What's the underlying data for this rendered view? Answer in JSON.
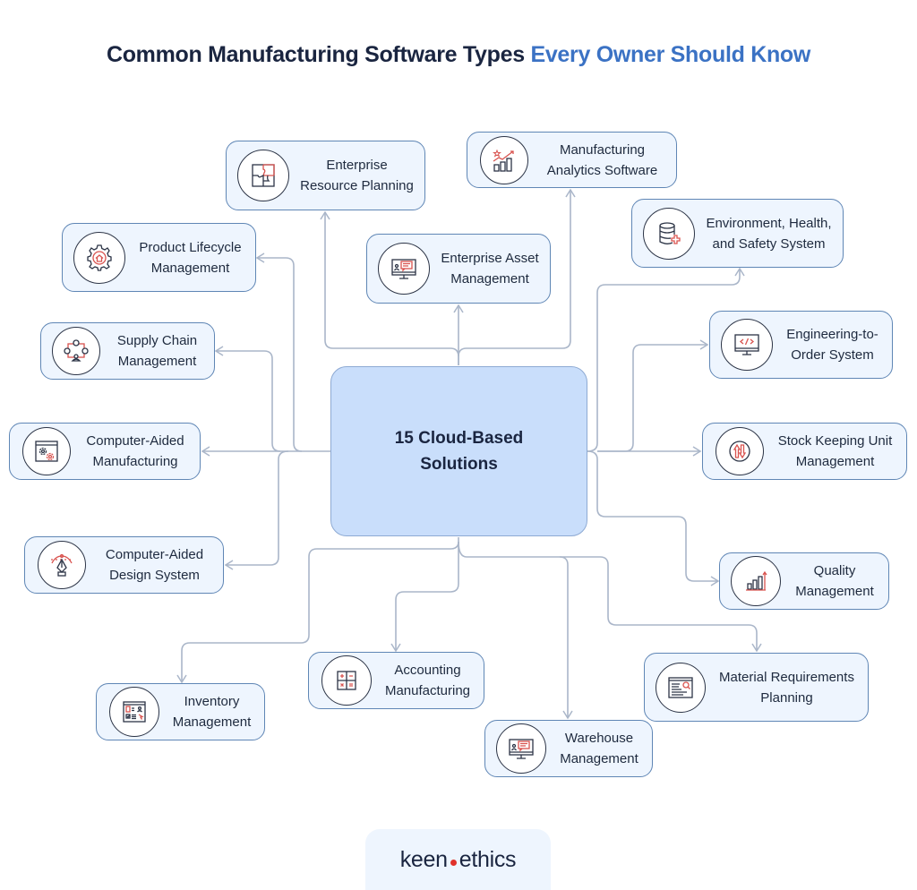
{
  "title": {
    "main": "Common Manufacturing Software Types",
    "accent": "Every Owner Should Know"
  },
  "colors": {
    "title": "#1a2540",
    "accent": "#3b72c4",
    "node_fill": "#eef5fe",
    "node_border": "#5f86b5",
    "center_fill": "#c9defb",
    "connector": "#aab6c9",
    "icon_red": "#d9534f"
  },
  "center": {
    "line1": "15 Cloud-Based",
    "line2": "Solutions"
  },
  "nodes": [
    {
      "id": "erp",
      "label": "Enterprise Resource Planning",
      "icon": "puzzle-icon"
    },
    {
      "id": "analytics",
      "label": "Manufacturing Analytics Software",
      "icon": "analytics-chart-icon"
    },
    {
      "id": "ehs",
      "label": "Environment, Health, and Safety System",
      "icon": "database-plus-icon"
    },
    {
      "id": "plm",
      "label": "Product Lifecycle Management",
      "icon": "gear-home-icon"
    },
    {
      "id": "eam",
      "label": "Enterprise Asset Management",
      "icon": "monitor-chat-icon"
    },
    {
      "id": "eto",
      "label": "Engineering-to-Order System",
      "icon": "monitor-code-icon"
    },
    {
      "id": "scm",
      "label": "Supply Chain Management",
      "icon": "supply-network-icon"
    },
    {
      "id": "cam",
      "label": "Computer-Aided Manufacturing",
      "icon": "window-gears-icon"
    },
    {
      "id": "sku",
      "label": "Stock Keeping Unit Management",
      "icon": "up-down-arrows-icon"
    },
    {
      "id": "cad",
      "label": "Computer-Aided Design System",
      "icon": "pen-tool-icon"
    },
    {
      "id": "qm",
      "label": "Quality Management",
      "icon": "bar-growth-icon"
    },
    {
      "id": "inv",
      "label": "Inventory Management",
      "icon": "checklist-window-icon"
    },
    {
      "id": "acc",
      "label": "Accounting Manufacturing",
      "icon": "calculator-icon"
    },
    {
      "id": "mrp",
      "label": "Material Requirements Planning",
      "icon": "document-search-icon"
    },
    {
      "id": "wms",
      "label": "Warehouse Management",
      "icon": "monitor-chat-icon"
    }
  ],
  "logo": {
    "left": "keen",
    "right": "ethics"
  }
}
